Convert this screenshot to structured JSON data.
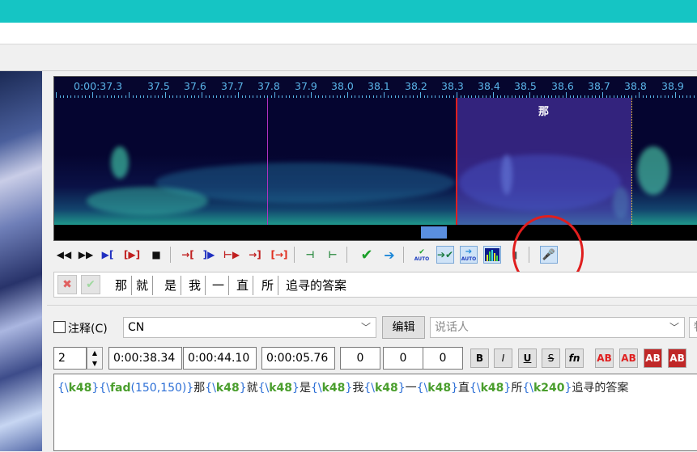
{
  "audio": {
    "timeline_labels": [
      "0:00:37.3",
      "37.5",
      "37.6",
      "37.7",
      "37.8",
      "37.9",
      "38.0",
      "38.1",
      "38.2",
      "38.3",
      "38.4",
      "38.5",
      "38.6",
      "38.7",
      "38.8",
      "38.9"
    ],
    "selected_syllable": "那"
  },
  "toolbar": {
    "icons": [
      "prev-line-icon",
      "next-line-icon",
      "play-selection-icon",
      "play-line-icon",
      "stop-icon",
      "play-before-start-icon",
      "play-after-start-icon",
      "play-before-end-icon",
      "play-after-end-icon",
      "play-to-end-icon",
      "shift-start-icon",
      "shift-end-icon",
      "commit-icon",
      "go-next-icon",
      "auto-commit-icon",
      "auto-next-commit-icon",
      "auto-scroll-icon",
      "spectrum-icon",
      "volume-icon",
      "karaoke-mode-icon"
    ]
  },
  "karaoke": {
    "cancel_icon": "cancel-icon",
    "accept_icon": "accept-check-icon",
    "syllables": [
      "那",
      "就",
      "是",
      "我",
      "一",
      "直",
      "所",
      "追寻的答案"
    ]
  },
  "editbox": {
    "comment_label": "注释(C)",
    "style_value": "CN",
    "edit_button": "编辑",
    "actor_placeholder": "说话人",
    "effect_partial": "特",
    "layer": "2",
    "start_time": "0:00:38.34",
    "end_time": "0:00:44.10",
    "duration": "0:00:05.76",
    "margin_l": "0",
    "margin_r": "0",
    "margin_v": "0",
    "format_buttons": [
      "B",
      "I",
      "U",
      "S",
      "fn",
      "AB",
      "AB",
      "AB",
      "AB"
    ],
    "text_segments": [
      {
        "t": "{\\",
        "c": "brace"
      },
      {
        "t": "k48",
        "c": "bold-k"
      },
      {
        "t": "}{\\",
        "c": "brace"
      },
      {
        "t": "fad",
        "c": "fad"
      },
      {
        "t": "(",
        "c": "brace"
      },
      {
        "t": "150",
        "c": "num"
      },
      {
        "t": ",",
        "c": "brace"
      },
      {
        "t": "150",
        "c": "num"
      },
      {
        "t": ")}",
        "c": "brace"
      },
      {
        "t": "那",
        "c": "plain"
      },
      {
        "t": "{\\",
        "c": "brace"
      },
      {
        "t": "k48",
        "c": "bold-k"
      },
      {
        "t": "}",
        "c": "brace"
      },
      {
        "t": "就",
        "c": "plain"
      },
      {
        "t": "{\\",
        "c": "brace"
      },
      {
        "t": "k48",
        "c": "bold-k"
      },
      {
        "t": "}",
        "c": "brace"
      },
      {
        "t": "是",
        "c": "plain"
      },
      {
        "t": "{\\",
        "c": "brace"
      },
      {
        "t": "k48",
        "c": "bold-k"
      },
      {
        "t": "}",
        "c": "brace"
      },
      {
        "t": "我",
        "c": "plain"
      },
      {
        "t": "{\\",
        "c": "brace"
      },
      {
        "t": "k48",
        "c": "bold-k"
      },
      {
        "t": "}",
        "c": "brace"
      },
      {
        "t": "一",
        "c": "plain"
      },
      {
        "t": "{\\",
        "c": "brace"
      },
      {
        "t": "k48",
        "c": "bold-k"
      },
      {
        "t": "}",
        "c": "brace"
      },
      {
        "t": "直",
        "c": "plain"
      },
      {
        "t": "{\\",
        "c": "brace"
      },
      {
        "t": "k48",
        "c": "bold-k"
      },
      {
        "t": "}",
        "c": "brace"
      },
      {
        "t": "所",
        "c": "plain"
      },
      {
        "t": "{\\",
        "c": "brace"
      },
      {
        "t": "k240",
        "c": "bold-k"
      },
      {
        "t": "}",
        "c": "brace"
      },
      {
        "t": "追寻的答案",
        "c": "plain"
      }
    ]
  },
  "colors": {
    "titlebar": "#15c5c4",
    "highlight_circle": "#e01e1e",
    "timeline_text": "#5ab4e8",
    "selection": "#5a3cbe"
  }
}
